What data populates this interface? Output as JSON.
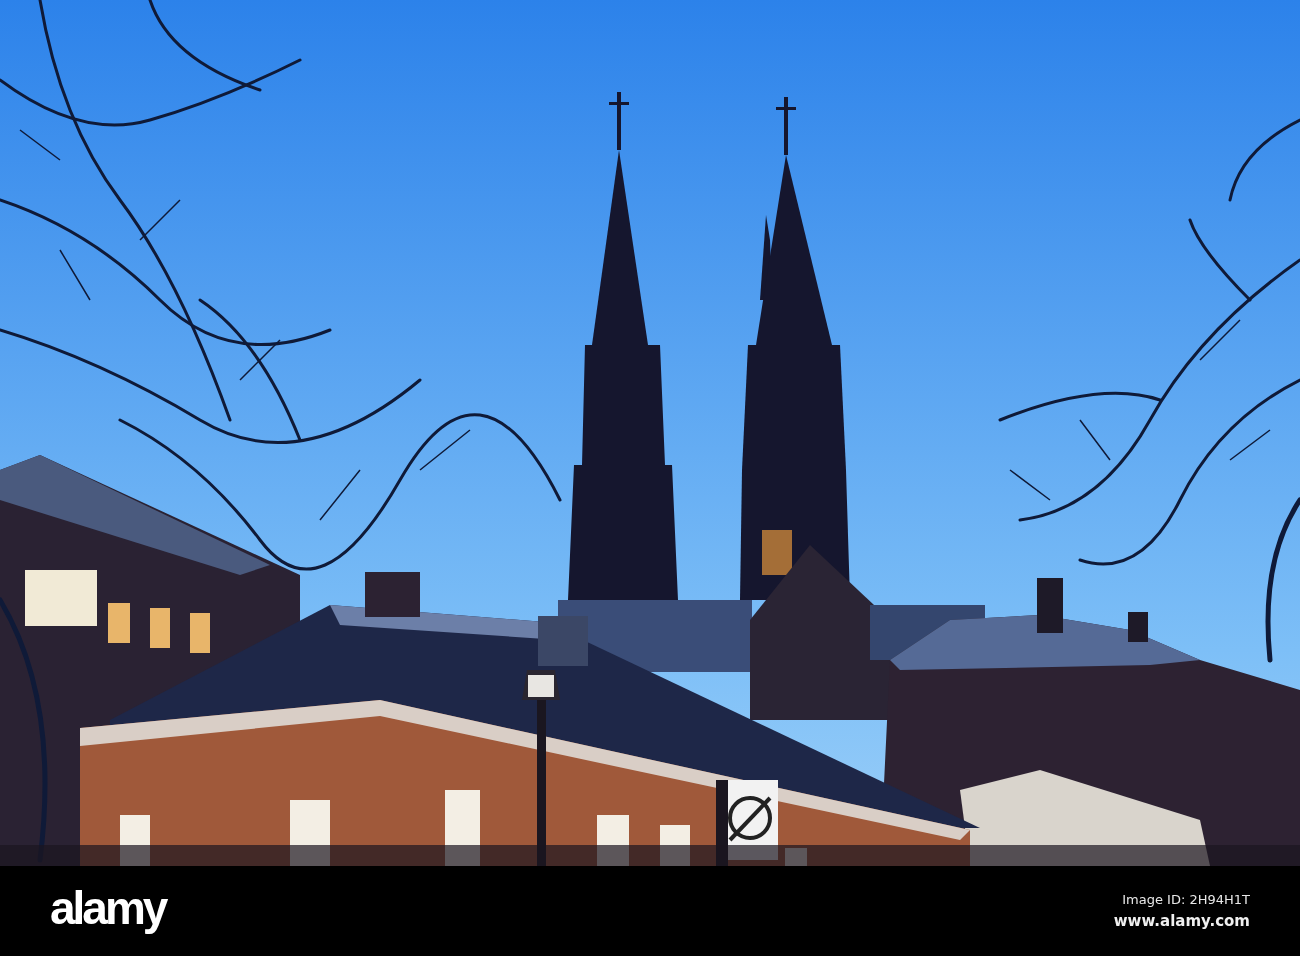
{
  "credit_bar": {
    "logo": "alamy",
    "image_id": "Image ID: 2H94H1T",
    "website": "www.alamy.com"
  }
}
